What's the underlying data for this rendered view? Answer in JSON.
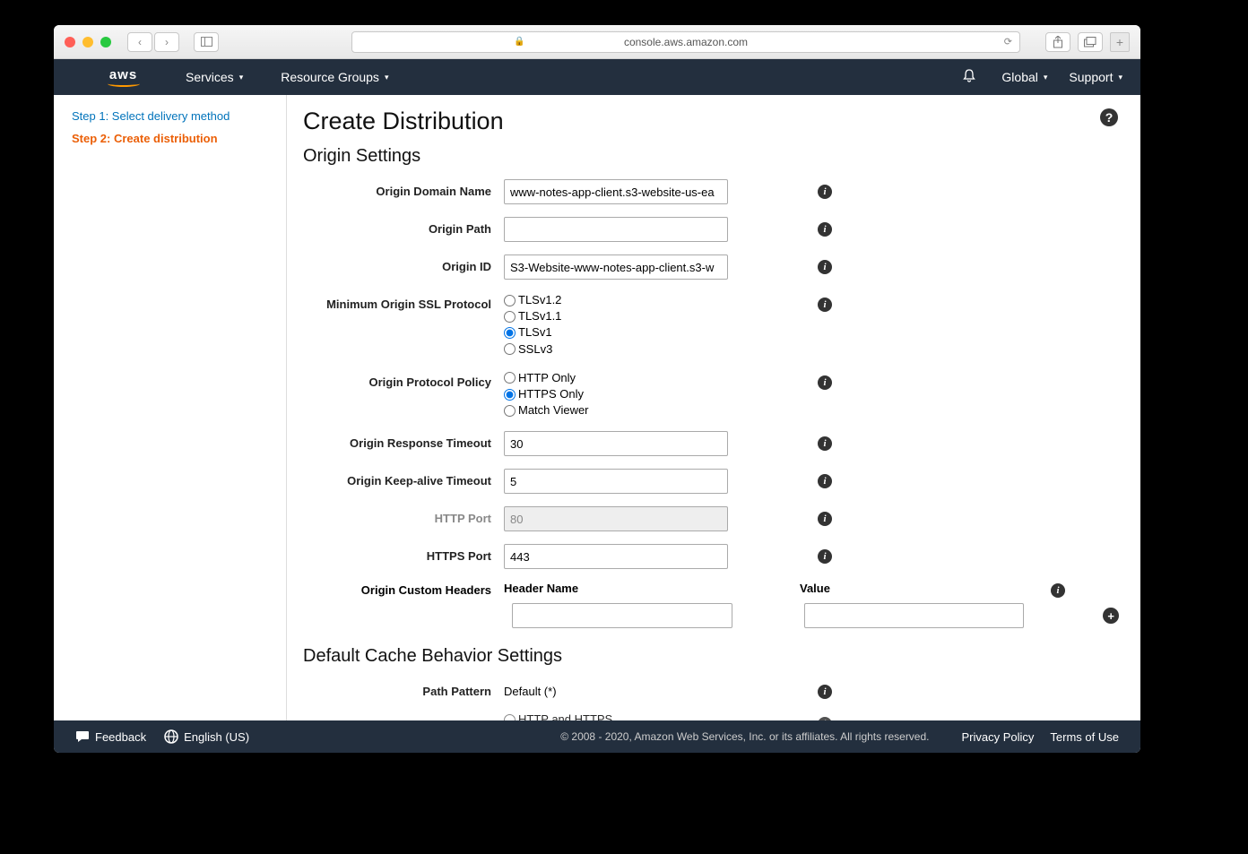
{
  "browser": {
    "url": "console.aws.amazon.com"
  },
  "nav": {
    "services": "Services",
    "resource_groups": "Resource Groups",
    "region": "Global",
    "support": "Support"
  },
  "steps": {
    "s1": "Step 1: Select delivery method",
    "s2": "Step 2: Create distribution"
  },
  "page": {
    "title": "Create Distribution",
    "section_origin": "Origin Settings",
    "section_cache": "Default Cache Behavior Settings"
  },
  "form": {
    "origin_domain_name": {
      "label": "Origin Domain Name",
      "value": "www-notes-app-client.s3-website-us-ea"
    },
    "origin_path": {
      "label": "Origin Path",
      "value": ""
    },
    "origin_id": {
      "label": "Origin ID",
      "value": "S3-Website-www-notes-app-client.s3-w"
    },
    "min_ssl": {
      "label": "Minimum Origin SSL Protocol",
      "options": [
        "TLSv1.2",
        "TLSv1.1",
        "TLSv1",
        "SSLv3"
      ],
      "selected": "TLSv1"
    },
    "protocol_policy": {
      "label": "Origin Protocol Policy",
      "options": [
        "HTTP Only",
        "HTTPS Only",
        "Match Viewer"
      ],
      "selected": "HTTPS Only"
    },
    "response_timeout": {
      "label": "Origin Response Timeout",
      "value": "30"
    },
    "keepalive_timeout": {
      "label": "Origin Keep-alive Timeout",
      "value": "5"
    },
    "http_port": {
      "label": "HTTP Port",
      "value": "80"
    },
    "https_port": {
      "label": "HTTPS Port",
      "value": "443"
    },
    "custom_headers": {
      "label": "Origin Custom Headers",
      "header_name": "Header Name",
      "value_label": "Value"
    },
    "path_pattern": {
      "label": "Path Pattern",
      "value": "Default (*)"
    },
    "viewer_protocol_partial": "HTTP and HTTPS"
  },
  "footer": {
    "feedback": "Feedback",
    "language": "English (US)",
    "copyright": "© 2008 - 2020, Amazon Web Services, Inc. or its affiliates. All rights reserved.",
    "privacy": "Privacy Policy",
    "terms": "Terms of Use"
  }
}
